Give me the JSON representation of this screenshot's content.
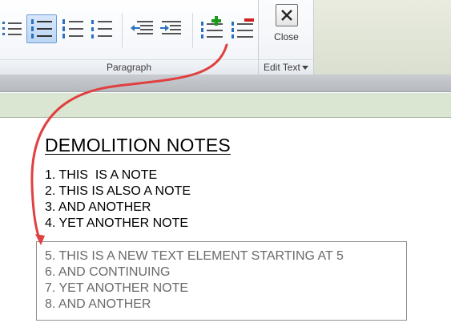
{
  "ribbon": {
    "paragraph_group_label": "Paragraph",
    "edit_text_group_label": "Edit Text",
    "close_label": "Close",
    "buttons": [
      {
        "name": "bullet-list-icon"
      },
      {
        "name": "numbered-list-icon",
        "selected": true
      },
      {
        "name": "lettered-list-icon"
      },
      {
        "name": "lowercase-list-icon"
      },
      {
        "name": "decrease-indent-icon"
      },
      {
        "name": "increase-indent-icon"
      },
      {
        "name": "increment-list-value-icon"
      },
      {
        "name": "decrement-list-value-icon"
      }
    ]
  },
  "document": {
    "title": "DEMOLITION NOTES",
    "notes": [
      "1. THIS  IS A NOTE",
      "2. THIS IS ALSO A NOTE",
      "3. AND ANOTHER",
      "4. YET ANOTHER NOTE"
    ],
    "new_text_element": [
      "5. THIS IS A NEW TEXT ELEMENT STARTING AT 5",
      "6. AND CONTINUING",
      "7. YET ANOTHER NOTE",
      "8. AND ANOTHER"
    ]
  },
  "colors": {
    "accent_blue": "#2b6fc0",
    "plus_green": "#1a9a1a",
    "minus_red": "#d02020",
    "arrow_red": "#e04040"
  }
}
